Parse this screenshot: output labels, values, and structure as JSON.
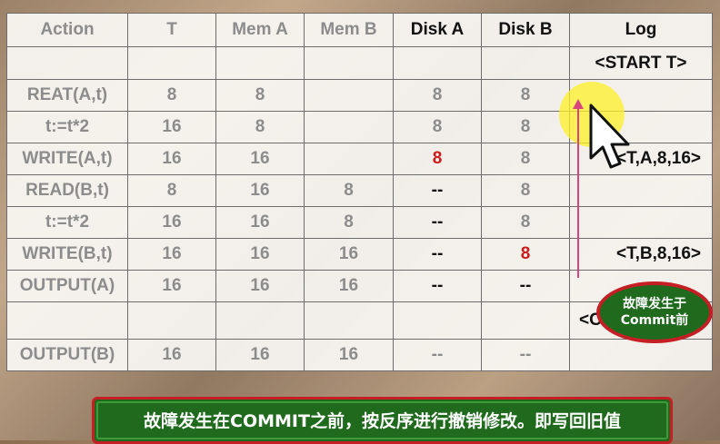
{
  "table": {
    "headers": [
      "Action",
      "T",
      "Mem A",
      "Mem B",
      "Disk A",
      "Disk B",
      "Log"
    ],
    "rows": [
      [
        "",
        "",
        "",
        "",
        "",
        "",
        "<START T>"
      ],
      [
        "REAT(A,t)",
        "8",
        "8",
        "",
        "8",
        "8",
        ""
      ],
      [
        "t:=t*2",
        "16",
        "8",
        "",
        "8",
        "8",
        ""
      ],
      [
        "WRITE(A,t)",
        "16",
        "16",
        "",
        "8",
        "8",
        "<T,A,8,16>"
      ],
      [
        "READ(B,t)",
        "8",
        "16",
        "8",
        "--",
        "8",
        ""
      ],
      [
        "t:=t*2",
        "16",
        "16",
        "8",
        "--",
        "8",
        ""
      ],
      [
        "WRITE(B,t)",
        "16",
        "16",
        "16",
        "--",
        "8",
        "<T,B,8,16>"
      ],
      [
        "OUTPUT(A)",
        "16",
        "16",
        "16",
        "--",
        "--",
        ""
      ],
      [
        "",
        "",
        "",
        "",
        "",
        "",
        "<C"
      ],
      [
        "OUTPUT(B)",
        "16",
        "16",
        "16",
        "--",
        "--",
        ""
      ]
    ]
  },
  "bubble": {
    "line1": "故障发生于",
    "line2": "Commit前"
  },
  "banner": {
    "text": "故障发生在COMMIT之前，按反序进行撤销修改。即写回旧值"
  },
  "colors": {
    "accent_red": "#cc1b1b",
    "green": "#1f6a1c",
    "arrow": "#d9437e",
    "highlight": "#ffee28"
  }
}
